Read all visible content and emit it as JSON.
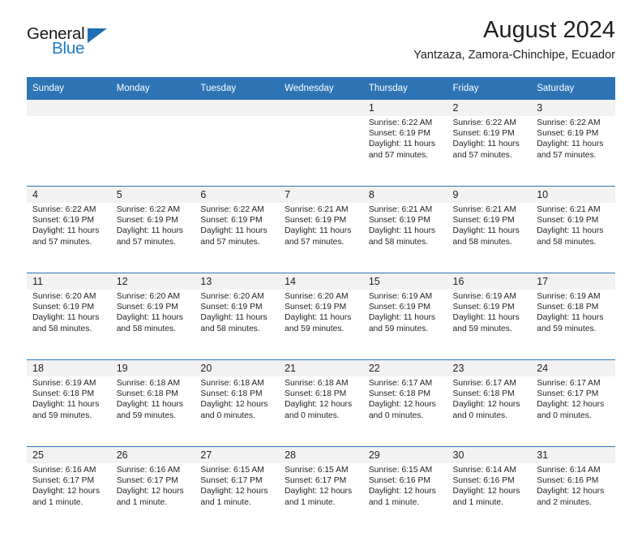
{
  "brand": {
    "name_part1": "General",
    "name_part2": "Blue",
    "accent_color": "#1f7ac4",
    "triangle_color": "#1f6eb4"
  },
  "header": {
    "title": "August 2024",
    "subtitle": "Yantzaza, Zamora-Chinchipe, Ecuador"
  },
  "theme": {
    "header_band": "#2e74b5",
    "daynum_band": "#f2f2f2",
    "text": "#231f20"
  },
  "weekday_headers": [
    "Sunday",
    "Monday",
    "Tuesday",
    "Wednesday",
    "Thursday",
    "Friday",
    "Saturday"
  ],
  "labels": {
    "sunrise_prefix": "Sunrise:",
    "sunset_prefix": "Sunset:",
    "daylight_prefix": "Daylight:"
  },
  "weeks": [
    {
      "days": [
        {
          "day": "",
          "sunrise": "",
          "sunset": "",
          "daylight_line1": "",
          "daylight_line2": ""
        },
        {
          "day": "",
          "sunrise": "",
          "sunset": "",
          "daylight_line1": "",
          "daylight_line2": ""
        },
        {
          "day": "",
          "sunrise": "",
          "sunset": "",
          "daylight_line1": "",
          "daylight_line2": ""
        },
        {
          "day": "",
          "sunrise": "",
          "sunset": "",
          "daylight_line1": "",
          "daylight_line2": ""
        },
        {
          "day": "1",
          "sunrise": "Sunrise: 6:22 AM",
          "sunset": "Sunset: 6:19 PM",
          "daylight_line1": "Daylight: 11 hours",
          "daylight_line2": "and 57 minutes."
        },
        {
          "day": "2",
          "sunrise": "Sunrise: 6:22 AM",
          "sunset": "Sunset: 6:19 PM",
          "daylight_line1": "Daylight: 11 hours",
          "daylight_line2": "and 57 minutes."
        },
        {
          "day": "3",
          "sunrise": "Sunrise: 6:22 AM",
          "sunset": "Sunset: 6:19 PM",
          "daylight_line1": "Daylight: 11 hours",
          "daylight_line2": "and 57 minutes."
        }
      ]
    },
    {
      "days": [
        {
          "day": "4",
          "sunrise": "Sunrise: 6:22 AM",
          "sunset": "Sunset: 6:19 PM",
          "daylight_line1": "Daylight: 11 hours",
          "daylight_line2": "and 57 minutes."
        },
        {
          "day": "5",
          "sunrise": "Sunrise: 6:22 AM",
          "sunset": "Sunset: 6:19 PM",
          "daylight_line1": "Daylight: 11 hours",
          "daylight_line2": "and 57 minutes."
        },
        {
          "day": "6",
          "sunrise": "Sunrise: 6:22 AM",
          "sunset": "Sunset: 6:19 PM",
          "daylight_line1": "Daylight: 11 hours",
          "daylight_line2": "and 57 minutes."
        },
        {
          "day": "7",
          "sunrise": "Sunrise: 6:21 AM",
          "sunset": "Sunset: 6:19 PM",
          "daylight_line1": "Daylight: 11 hours",
          "daylight_line2": "and 57 minutes."
        },
        {
          "day": "8",
          "sunrise": "Sunrise: 6:21 AM",
          "sunset": "Sunset: 6:19 PM",
          "daylight_line1": "Daylight: 11 hours",
          "daylight_line2": "and 58 minutes."
        },
        {
          "day": "9",
          "sunrise": "Sunrise: 6:21 AM",
          "sunset": "Sunset: 6:19 PM",
          "daylight_line1": "Daylight: 11 hours",
          "daylight_line2": "and 58 minutes."
        },
        {
          "day": "10",
          "sunrise": "Sunrise: 6:21 AM",
          "sunset": "Sunset: 6:19 PM",
          "daylight_line1": "Daylight: 11 hours",
          "daylight_line2": "and 58 minutes."
        }
      ]
    },
    {
      "days": [
        {
          "day": "11",
          "sunrise": "Sunrise: 6:20 AM",
          "sunset": "Sunset: 6:19 PM",
          "daylight_line1": "Daylight: 11 hours",
          "daylight_line2": "and 58 minutes."
        },
        {
          "day": "12",
          "sunrise": "Sunrise: 6:20 AM",
          "sunset": "Sunset: 6:19 PM",
          "daylight_line1": "Daylight: 11 hours",
          "daylight_line2": "and 58 minutes."
        },
        {
          "day": "13",
          "sunrise": "Sunrise: 6:20 AM",
          "sunset": "Sunset: 6:19 PM",
          "daylight_line1": "Daylight: 11 hours",
          "daylight_line2": "and 58 minutes."
        },
        {
          "day": "14",
          "sunrise": "Sunrise: 6:20 AM",
          "sunset": "Sunset: 6:19 PM",
          "daylight_line1": "Daylight: 11 hours",
          "daylight_line2": "and 59 minutes."
        },
        {
          "day": "15",
          "sunrise": "Sunrise: 6:19 AM",
          "sunset": "Sunset: 6:19 PM",
          "daylight_line1": "Daylight: 11 hours",
          "daylight_line2": "and 59 minutes."
        },
        {
          "day": "16",
          "sunrise": "Sunrise: 6:19 AM",
          "sunset": "Sunset: 6:19 PM",
          "daylight_line1": "Daylight: 11 hours",
          "daylight_line2": "and 59 minutes."
        },
        {
          "day": "17",
          "sunrise": "Sunrise: 6:19 AM",
          "sunset": "Sunset: 6:18 PM",
          "daylight_line1": "Daylight: 11 hours",
          "daylight_line2": "and 59 minutes."
        }
      ]
    },
    {
      "days": [
        {
          "day": "18",
          "sunrise": "Sunrise: 6:19 AM",
          "sunset": "Sunset: 6:18 PM",
          "daylight_line1": "Daylight: 11 hours",
          "daylight_line2": "and 59 minutes."
        },
        {
          "day": "19",
          "sunrise": "Sunrise: 6:18 AM",
          "sunset": "Sunset: 6:18 PM",
          "daylight_line1": "Daylight: 11 hours",
          "daylight_line2": "and 59 minutes."
        },
        {
          "day": "20",
          "sunrise": "Sunrise: 6:18 AM",
          "sunset": "Sunset: 6:18 PM",
          "daylight_line1": "Daylight: 12 hours",
          "daylight_line2": "and 0 minutes."
        },
        {
          "day": "21",
          "sunrise": "Sunrise: 6:18 AM",
          "sunset": "Sunset: 6:18 PM",
          "daylight_line1": "Daylight: 12 hours",
          "daylight_line2": "and 0 minutes."
        },
        {
          "day": "22",
          "sunrise": "Sunrise: 6:17 AM",
          "sunset": "Sunset: 6:18 PM",
          "daylight_line1": "Daylight: 12 hours",
          "daylight_line2": "and 0 minutes."
        },
        {
          "day": "23",
          "sunrise": "Sunrise: 6:17 AM",
          "sunset": "Sunset: 6:18 PM",
          "daylight_line1": "Daylight: 12 hours",
          "daylight_line2": "and 0 minutes."
        },
        {
          "day": "24",
          "sunrise": "Sunrise: 6:17 AM",
          "sunset": "Sunset: 6:17 PM",
          "daylight_line1": "Daylight: 12 hours",
          "daylight_line2": "and 0 minutes."
        }
      ]
    },
    {
      "days": [
        {
          "day": "25",
          "sunrise": "Sunrise: 6:16 AM",
          "sunset": "Sunset: 6:17 PM",
          "daylight_line1": "Daylight: 12 hours",
          "daylight_line2": "and 1 minute."
        },
        {
          "day": "26",
          "sunrise": "Sunrise: 6:16 AM",
          "sunset": "Sunset: 6:17 PM",
          "daylight_line1": "Daylight: 12 hours",
          "daylight_line2": "and 1 minute."
        },
        {
          "day": "27",
          "sunrise": "Sunrise: 6:15 AM",
          "sunset": "Sunset: 6:17 PM",
          "daylight_line1": "Daylight: 12 hours",
          "daylight_line2": "and 1 minute."
        },
        {
          "day": "28",
          "sunrise": "Sunrise: 6:15 AM",
          "sunset": "Sunset: 6:17 PM",
          "daylight_line1": "Daylight: 12 hours",
          "daylight_line2": "and 1 minute."
        },
        {
          "day": "29",
          "sunrise": "Sunrise: 6:15 AM",
          "sunset": "Sunset: 6:16 PM",
          "daylight_line1": "Daylight: 12 hours",
          "daylight_line2": "and 1 minute."
        },
        {
          "day": "30",
          "sunrise": "Sunrise: 6:14 AM",
          "sunset": "Sunset: 6:16 PM",
          "daylight_line1": "Daylight: 12 hours",
          "daylight_line2": "and 1 minute."
        },
        {
          "day": "31",
          "sunrise": "Sunrise: 6:14 AM",
          "sunset": "Sunset: 6:16 PM",
          "daylight_line1": "Daylight: 12 hours",
          "daylight_line2": "and 2 minutes."
        }
      ]
    }
  ]
}
